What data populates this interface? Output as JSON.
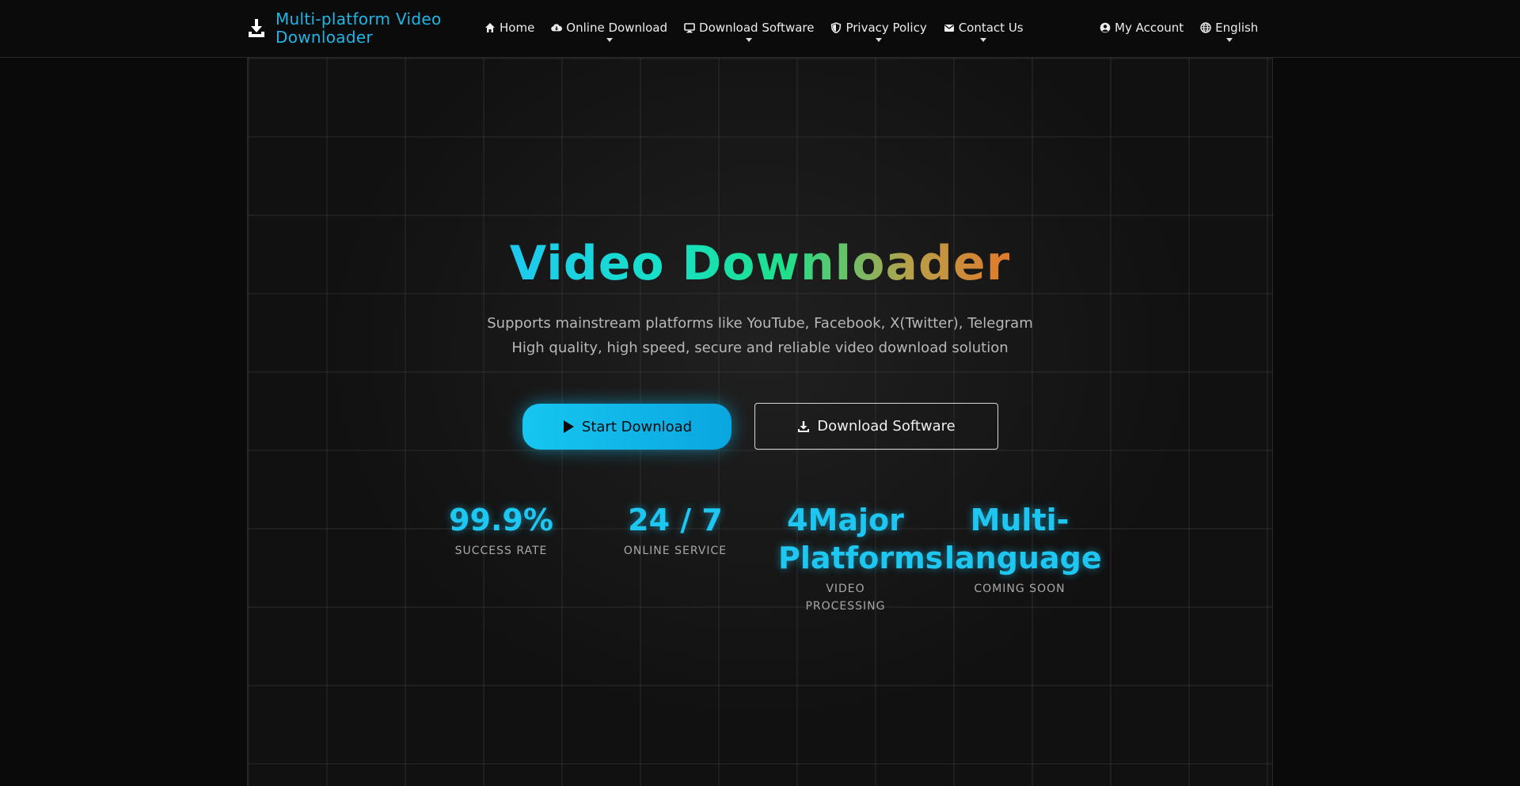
{
  "nav": {
    "brand": "Multi-platform Video Downloader",
    "brand_icon": "download-tray-icon",
    "links": [
      {
        "label": "Home",
        "icon": "home-icon",
        "dropdown": false
      },
      {
        "label": "Online Download",
        "icon": "cloud-download-icon",
        "dropdown": true
      },
      {
        "label": "Download Software",
        "icon": "desktop-icon",
        "dropdown": true
      },
      {
        "label": "Privacy Policy",
        "icon": "shield-icon",
        "dropdown": true
      },
      {
        "label": "Contact Us",
        "icon": "envelope-icon",
        "dropdown": true
      }
    ],
    "account": {
      "label": "My Account",
      "icon": "user-circle-icon"
    },
    "language": {
      "label": "English",
      "icon": "globe-icon",
      "dropdown": true
    }
  },
  "hero": {
    "title": "Video Downloader",
    "subtitle_line1": "Supports mainstream platforms like YouTube, Facebook, X(Twitter), Telegram",
    "subtitle_line2": "High quality, high speed, secure and reliable video download solution",
    "primary_button": {
      "label": "Start Download",
      "icon": "play-icon"
    },
    "secondary_button": {
      "label": "Download Software",
      "icon": "download-icon"
    }
  },
  "stats": [
    {
      "value": "99.9%",
      "label": "SUCCESS RATE"
    },
    {
      "value": "24 / 7",
      "label": "ONLINE SERVICE"
    },
    {
      "value": "4Major Platforms",
      "label": "VIDEO PROCESSING"
    },
    {
      "value": "Multi-language",
      "label": "COMING SOON"
    }
  ],
  "colors": {
    "accent": "#1ec6f2",
    "background": "#0a0a0a",
    "panel": "#111111"
  }
}
